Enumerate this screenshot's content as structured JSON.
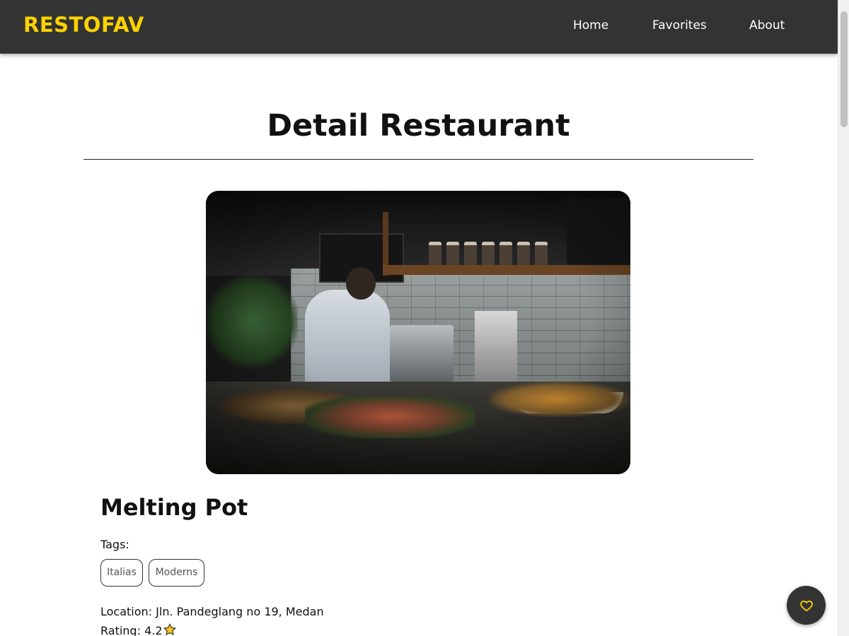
{
  "navbar": {
    "brand": "RESTOFAV",
    "links": [
      {
        "label": "Home"
      },
      {
        "label": "Favorites"
      },
      {
        "label": "About"
      }
    ]
  },
  "main": {
    "title": "Detail Restaurant"
  },
  "restaurant": {
    "name": "Melting Pot",
    "tags_label": "Tags:",
    "tags": [
      "Italias",
      "Moderns"
    ],
    "location_label": "Location: ",
    "location": "Jln. Pandeglang no 19, Medan",
    "rating_label": "Rating: ",
    "rating": "4.2"
  },
  "icons": {
    "rating": "star-icon",
    "favorite": "heart-outline-icon"
  },
  "colors": {
    "navbar_bg": "#333333",
    "brand": "#ffd200",
    "accent": "#ffd200",
    "star": "#f5c518"
  }
}
